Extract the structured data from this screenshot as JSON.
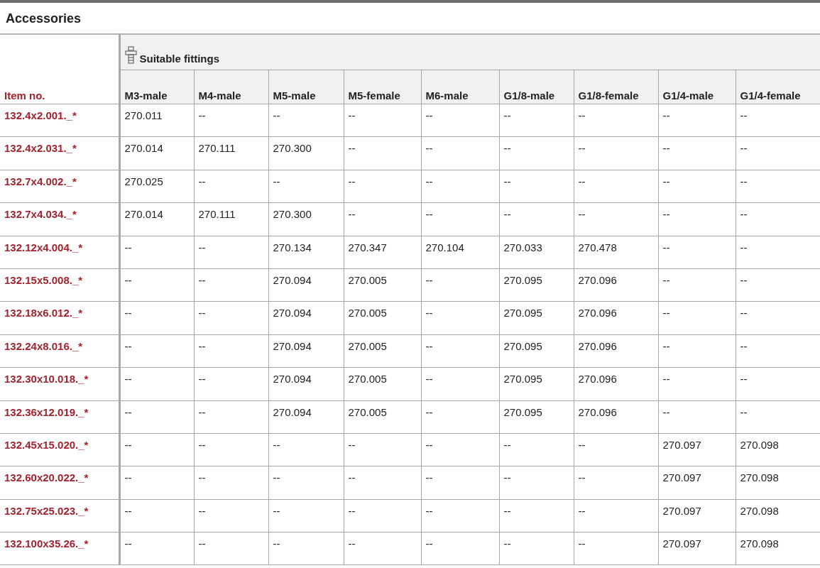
{
  "title": "Accessories",
  "table": {
    "item_header": "Item no.",
    "group_header": "Suitable fittings",
    "columns": [
      "M3-male",
      "M4-male",
      "M5-male",
      "M5-female",
      "M6-male",
      "G1/8-male",
      "G1/8-female",
      "G1/4-male",
      "G1/4-female"
    ],
    "rows": [
      {
        "item": "132.4x2.001._*",
        "cells": [
          "270.011",
          "--",
          "--",
          "--",
          "--",
          "--",
          "--",
          "--",
          "--"
        ]
      },
      {
        "item": "132.4x2.031._*",
        "cells": [
          "270.014",
          "270.111",
          "270.300",
          "--",
          "--",
          "--",
          "--",
          "--",
          "--"
        ]
      },
      {
        "item": "132.7x4.002._*",
        "cells": [
          "270.025",
          "--",
          "--",
          "--",
          "--",
          "--",
          "--",
          "--",
          "--"
        ]
      },
      {
        "item": "132.7x4.034._*",
        "cells": [
          "270.014",
          "270.111",
          "270.300",
          "--",
          "--",
          "--",
          "--",
          "--",
          "--"
        ]
      },
      {
        "item": "132.12x4.004._*",
        "cells": [
          "--",
          "--",
          "270.134",
          "270.347",
          "270.104",
          "270.033",
          "270.478",
          "--",
          "--"
        ]
      },
      {
        "item": "132.15x5.008._*",
        "cells": [
          "--",
          "--",
          "270.094",
          "270.005",
          "--",
          "270.095",
          "270.096",
          "--",
          "--"
        ]
      },
      {
        "item": "132.18x6.012._*",
        "cells": [
          "--",
          "--",
          "270.094",
          "270.005",
          "--",
          "270.095",
          "270.096",
          "--",
          "--"
        ]
      },
      {
        "item": "132.24x8.016._*",
        "cells": [
          "--",
          "--",
          "270.094",
          "270.005",
          "--",
          "270.095",
          "270.096",
          "--",
          "--"
        ]
      },
      {
        "item": "132.30x10.018._*",
        "cells": [
          "--",
          "--",
          "270.094",
          "270.005",
          "--",
          "270.095",
          "270.096",
          "--",
          "--"
        ]
      },
      {
        "item": "132.36x12.019._*",
        "cells": [
          "--",
          "--",
          "270.094",
          "270.005",
          "--",
          "270.095",
          "270.096",
          "--",
          "--"
        ]
      },
      {
        "item": "132.45x15.020._*",
        "cells": [
          "--",
          "--",
          "--",
          "--",
          "--",
          "--",
          "--",
          "270.097",
          "270.098"
        ]
      },
      {
        "item": "132.60x20.022._*",
        "cells": [
          "--",
          "--",
          "--",
          "--",
          "--",
          "--",
          "--",
          "270.097",
          "270.098"
        ]
      },
      {
        "item": "132.75x25.023._*",
        "cells": [
          "--",
          "--",
          "--",
          "--",
          "--",
          "--",
          "--",
          "270.097",
          "270.098"
        ]
      },
      {
        "item": "132.100x35.26._*",
        "cells": [
          "--",
          "--",
          "--",
          "--",
          "--",
          "--",
          "--",
          "270.097",
          "270.098"
        ]
      }
    ]
  }
}
